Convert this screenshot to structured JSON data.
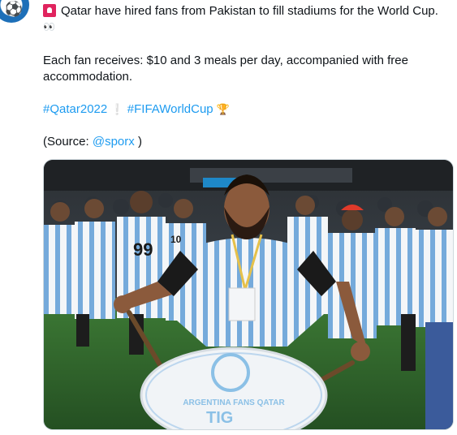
{
  "tweet": {
    "avatar_icon": "soccer-ball-icon",
    "alert_icon": "rotating-light-icon",
    "line1": "Qatar have hired fans from Pakistan to fill stadiums for the World Cup.",
    "eyes_emoji": "👀",
    "line2": "Each fan receives: $10 and 3 meals per day, accompanied with free",
    "line3": "accommodation.",
    "hashtag1": "#Qatar2022",
    "hashtag1_emoji": "❕",
    "hashtag2": "#FIFAWorldCup",
    "hashtag2_emoji": "🏆",
    "source_prefix": "(Source: ",
    "source_handle": "@sporx",
    "source_suffix": " )"
  },
  "photo": {
    "drum_text_top": "ARGENTINA FANS QATAR",
    "drum_logo": "TIG",
    "jersey_numbers": [
      "99",
      "10"
    ]
  },
  "colors": {
    "link": "#1d9bf0",
    "pitch": "#2f6b2c",
    "jersey_blue": "#75aadb"
  }
}
